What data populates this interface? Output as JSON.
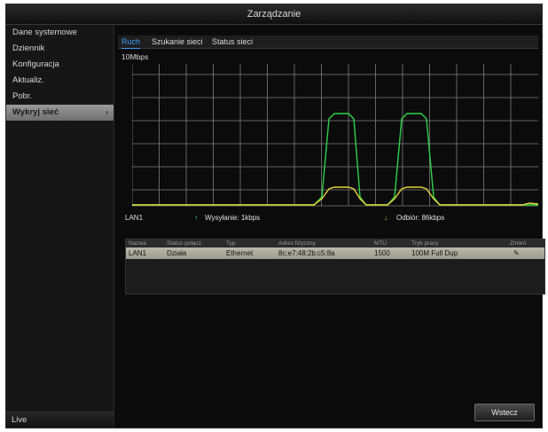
{
  "window": {
    "title": "Zarządzanie"
  },
  "sidebar": {
    "items": [
      {
        "label": "Dane systemowe"
      },
      {
        "label": "Dziennik"
      },
      {
        "label": "Konfiguracja"
      },
      {
        "label": "Aktualiz."
      },
      {
        "label": "Pobr."
      },
      {
        "label": "Wykryj sieć",
        "chevron": "›"
      }
    ],
    "active_index": 5,
    "bottom_label": "Live"
  },
  "tabs": [
    {
      "label": "Ruch"
    },
    {
      "label": "Szukanie sieci"
    },
    {
      "label": "Status sieci"
    }
  ],
  "active_tab": 0,
  "graph": {
    "rate_label": "10Mbps",
    "send_color": "#2fd24a",
    "recv_color": "#e8d23a",
    "grid_color": "#8a8a8a"
  },
  "legend": {
    "interface": "LAN1",
    "send_icon": "↑",
    "send_text": "Wysyłanie: 1kbps",
    "recv_icon": "↓",
    "recv_text": "Odbiór: 86kbps"
  },
  "table": {
    "headers": [
      "Nazwa",
      "Status połącz.",
      "Typ",
      "Adres fizyczny",
      "MTU",
      "Tryb pracy",
      "Zmień"
    ],
    "rows": [
      [
        "LAN1",
        "Działa",
        "Ethernet",
        "8c:e7:48:2b:c5:8a",
        "1500",
        "100M Full Dup",
        "✎"
      ]
    ]
  },
  "buttons": {
    "exit": "Wstecz"
  }
}
